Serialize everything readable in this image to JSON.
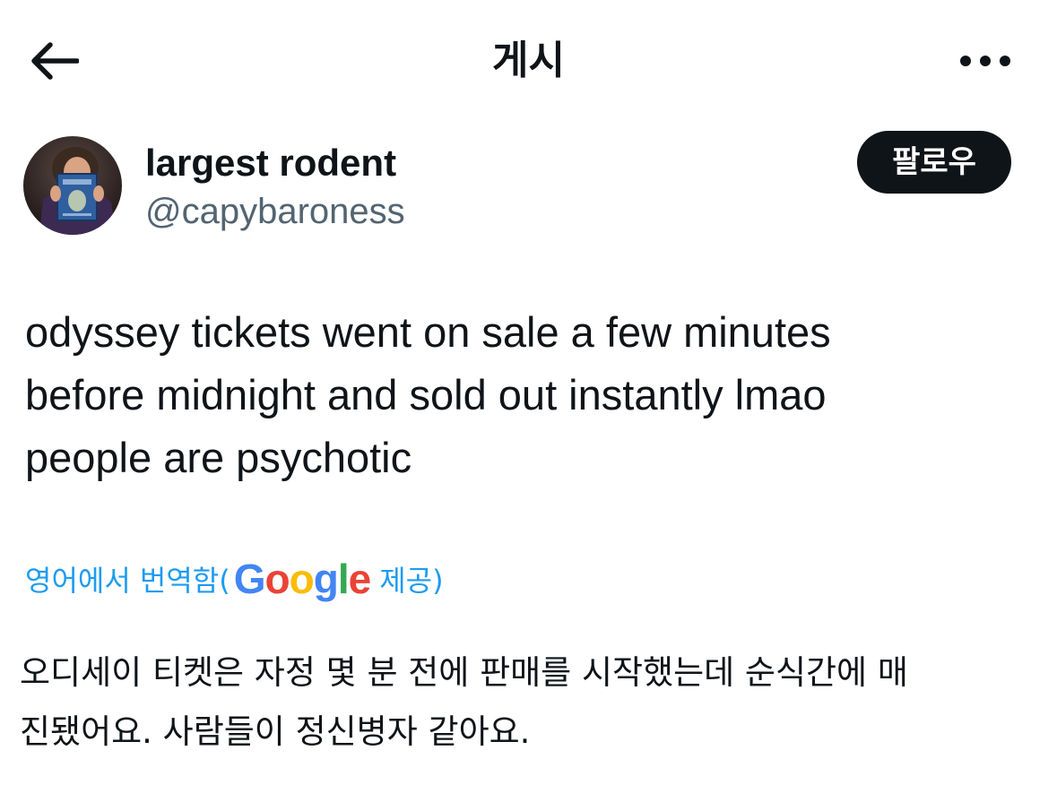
{
  "header": {
    "title": "게시",
    "back_icon": "arrow-left-icon",
    "more_icon": "more-horizontal-icon"
  },
  "author": {
    "display_name": "largest rodent",
    "handle": "@capybaroness",
    "follow_label": "팔로우"
  },
  "tweet": {
    "text": "odyssey tickets went on sale a few minutes\nbefore midnight and sold out instantly lmao\npeople are psychotic"
  },
  "translation": {
    "prefix": "영어에서 번역함(",
    "provider": [
      "G",
      "o",
      "o",
      "g",
      "l",
      "e"
    ],
    "suffix": " 제공)",
    "translated_text": "오디세이 티켓은 자정 몇 분 전에 판매를 시작했는데 순식간에 매\n진됐어요. 사람들이 정신병자 같아요."
  },
  "colors": {
    "text": "#0f1419",
    "secondary": "#536471",
    "link": "#1d9bf0",
    "follow_bg": "#0f1419",
    "google_blue": "#4285f4",
    "google_red": "#ea4335",
    "google_yellow": "#fbbc05",
    "google_green": "#34a853"
  }
}
